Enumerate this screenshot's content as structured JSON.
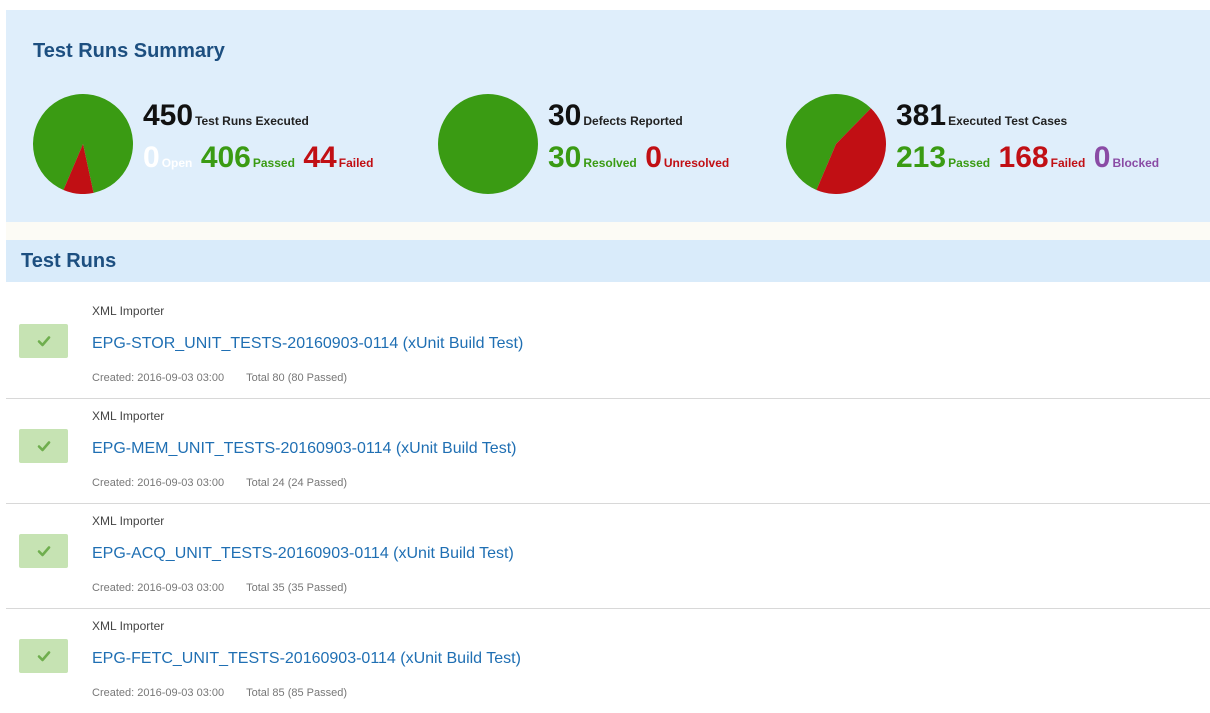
{
  "summary": {
    "title": "Test Runs Summary",
    "colors": {
      "passed": "#3a9b13",
      "failed": "#c10f14",
      "blocked": "#8a4ba5",
      "open": "#ffffff"
    },
    "test_runs": {
      "total": "450",
      "total_label": "Test Runs Executed",
      "open": "0",
      "open_label": "Open",
      "passed": "406",
      "passed_label": "Passed",
      "failed": "44",
      "failed_label": "Failed",
      "pie": [
        406,
        44
      ]
    },
    "defects": {
      "total": "30",
      "total_label": "Defects Reported",
      "resolved": "30",
      "resolved_label": "Resolved",
      "unresolved": "0",
      "unresolved_label": "Unresolved",
      "pie": [
        30,
        0
      ]
    },
    "test_cases": {
      "total": "381",
      "total_label": "Executed Test Cases",
      "passed": "213",
      "passed_label": "Passed",
      "failed": "168",
      "failed_label": "Failed",
      "blocked": "0",
      "blocked_label": "Blocked",
      "pie": [
        213,
        168
      ]
    }
  },
  "runs": {
    "title": "Test Runs",
    "items": [
      {
        "source": "XML Importer",
        "title": "EPG-STOR_UNIT_TESTS-20160903-0114 (xUnit Build Test)",
        "created": "Created: 2016-09-03 03:00",
        "total": "Total 80 (80 Passed)"
      },
      {
        "source": "XML Importer",
        "title": "EPG-MEM_UNIT_TESTS-20160903-0114 (xUnit Build Test)",
        "created": "Created: 2016-09-03 03:00",
        "total": "Total 24 (24 Passed)"
      },
      {
        "source": "XML Importer",
        "title": "EPG-ACQ_UNIT_TESTS-20160903-0114 (xUnit Build Test)",
        "created": "Created: 2016-09-03 03:00",
        "total": "Total 35 (35 Passed)"
      },
      {
        "source": "XML Importer",
        "title": "EPG-FETC_UNIT_TESTS-20160903-0114 (xUnit Build Test)",
        "created": "Created: 2016-09-03 03:00",
        "total": "Total 85 (85 Passed)"
      }
    ]
  }
}
